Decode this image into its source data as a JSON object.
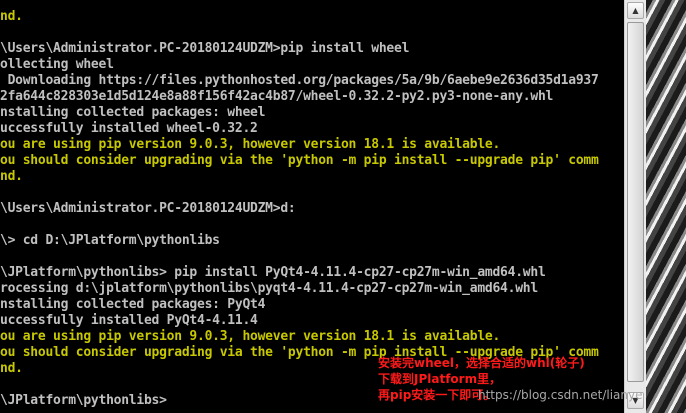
{
  "terminal": {
    "lines": [
      {
        "text": "nd.",
        "kind": "warn"
      },
      {
        "text": "",
        "kind": "normal"
      },
      {
        "text": "\\Users\\Administrator.PC-20180124UDZM>pip install wheel",
        "kind": "normal"
      },
      {
        "text": "ollecting wheel",
        "kind": "normal"
      },
      {
        "text": " Downloading https://files.pythonhosted.org/packages/5a/9b/6aebe9e2636d35d1a937",
        "kind": "normal"
      },
      {
        "text": "2fa644c828303e1d5d124e8a88f156f42ac4b87/wheel-0.32.2-py2.py3-none-any.whl",
        "kind": "normal"
      },
      {
        "text": "nstalling collected packages: wheel",
        "kind": "normal"
      },
      {
        "text": "uccessfully installed wheel-0.32.2",
        "kind": "normal"
      },
      {
        "text": "ou are using pip version 9.0.3, however version 18.1 is available.",
        "kind": "warn"
      },
      {
        "text": "ou should consider upgrading via the 'python -m pip install --upgrade pip' comm",
        "kind": "warn"
      },
      {
        "text": "nd.",
        "kind": "warn"
      },
      {
        "text": "",
        "kind": "normal"
      },
      {
        "text": "\\Users\\Administrator.PC-20180124UDZM>d:",
        "kind": "normal"
      },
      {
        "text": "",
        "kind": "normal"
      },
      {
        "text": "\\> cd D:\\JPlatform\\pythonlibs",
        "kind": "normal"
      },
      {
        "text": "",
        "kind": "normal"
      },
      {
        "text": "\\JPlatform\\pythonlibs> pip install PyQt4-4.11.4-cp27-cp27m-win_amd64.whl",
        "kind": "normal"
      },
      {
        "text": "rocessing d:\\jplatform\\pythonlibs\\pyqt4-4.11.4-cp27-cp27m-win_amd64.whl",
        "kind": "normal"
      },
      {
        "text": "nstalling collected packages: PyQt4",
        "kind": "normal"
      },
      {
        "text": "uccessfully installed PyQt4-4.11.4",
        "kind": "normal"
      },
      {
        "text": "ou are using pip version 9.0.3, however version 18.1 is available.",
        "kind": "warn"
      },
      {
        "text": "ou should consider upgrading via the 'python -m pip install --upgrade pip' comm",
        "kind": "warn"
      },
      {
        "text": "nd.",
        "kind": "warn"
      },
      {
        "text": "",
        "kind": "normal"
      },
      {
        "text": "\\JPlatform\\pythonlibs>",
        "kind": "normal"
      }
    ]
  },
  "scrollbar": {
    "up_icon": "chevron-up-icon",
    "down_icon": "chevron-down-icon",
    "up_glyph": "▲",
    "down_glyph": "▼"
  },
  "annotation": {
    "line1": "安装完wheel，选择合适的whl(轮子)",
    "line2": "下载到JPlatform里，",
    "line3": "再pip安装一下即可。",
    "color": "#ff1a1a"
  },
  "watermark": "https://blog.csdn.net/lianye",
  "colors": {
    "terminal_bg": "#000000",
    "terminal_text": "#c0c0c0",
    "warning_text": "#c8c800"
  }
}
